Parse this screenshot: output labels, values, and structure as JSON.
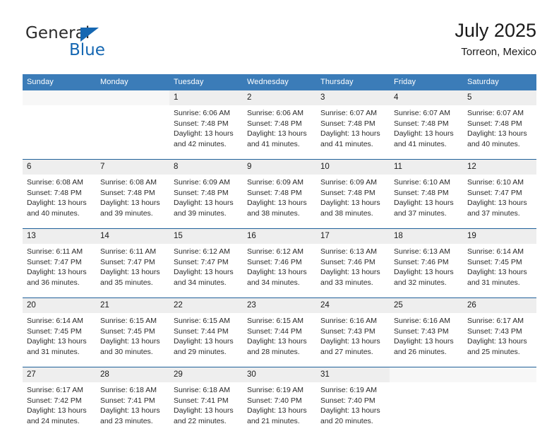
{
  "logo": {
    "word1": "General",
    "word2": "Blue",
    "triangle_color": "#1567b2"
  },
  "header": {
    "title": "July 2025",
    "subtitle": "Torreon, Mexico"
  },
  "theme": {
    "header_blue": "#3b7cb8",
    "separator_blue": "#1f6099",
    "daynum_band": "#eeeeee"
  },
  "weekdays": [
    "Sunday",
    "Monday",
    "Tuesday",
    "Wednesday",
    "Thursday",
    "Friday",
    "Saturday"
  ],
  "weeks": [
    {
      "days": [
        {
          "num": "",
          "sunrise": "",
          "sunset": "",
          "daylight1": "",
          "daylight2": ""
        },
        {
          "num": "",
          "sunrise": "",
          "sunset": "",
          "daylight1": "",
          "daylight2": ""
        },
        {
          "num": "1",
          "sunrise": "Sunrise: 6:06 AM",
          "sunset": "Sunset: 7:48 PM",
          "daylight1": "Daylight: 13 hours",
          "daylight2": "and 42 minutes."
        },
        {
          "num": "2",
          "sunrise": "Sunrise: 6:06 AM",
          "sunset": "Sunset: 7:48 PM",
          "daylight1": "Daylight: 13 hours",
          "daylight2": "and 41 minutes."
        },
        {
          "num": "3",
          "sunrise": "Sunrise: 6:07 AM",
          "sunset": "Sunset: 7:48 PM",
          "daylight1": "Daylight: 13 hours",
          "daylight2": "and 41 minutes."
        },
        {
          "num": "4",
          "sunrise": "Sunrise: 6:07 AM",
          "sunset": "Sunset: 7:48 PM",
          "daylight1": "Daylight: 13 hours",
          "daylight2": "and 41 minutes."
        },
        {
          "num": "5",
          "sunrise": "Sunrise: 6:07 AM",
          "sunset": "Sunset: 7:48 PM",
          "daylight1": "Daylight: 13 hours",
          "daylight2": "and 40 minutes."
        }
      ]
    },
    {
      "days": [
        {
          "num": "6",
          "sunrise": "Sunrise: 6:08 AM",
          "sunset": "Sunset: 7:48 PM",
          "daylight1": "Daylight: 13 hours",
          "daylight2": "and 40 minutes."
        },
        {
          "num": "7",
          "sunrise": "Sunrise: 6:08 AM",
          "sunset": "Sunset: 7:48 PM",
          "daylight1": "Daylight: 13 hours",
          "daylight2": "and 39 minutes."
        },
        {
          "num": "8",
          "sunrise": "Sunrise: 6:09 AM",
          "sunset": "Sunset: 7:48 PM",
          "daylight1": "Daylight: 13 hours",
          "daylight2": "and 39 minutes."
        },
        {
          "num": "9",
          "sunrise": "Sunrise: 6:09 AM",
          "sunset": "Sunset: 7:48 PM",
          "daylight1": "Daylight: 13 hours",
          "daylight2": "and 38 minutes."
        },
        {
          "num": "10",
          "sunrise": "Sunrise: 6:09 AM",
          "sunset": "Sunset: 7:48 PM",
          "daylight1": "Daylight: 13 hours",
          "daylight2": "and 38 minutes."
        },
        {
          "num": "11",
          "sunrise": "Sunrise: 6:10 AM",
          "sunset": "Sunset: 7:48 PM",
          "daylight1": "Daylight: 13 hours",
          "daylight2": "and 37 minutes."
        },
        {
          "num": "12",
          "sunrise": "Sunrise: 6:10 AM",
          "sunset": "Sunset: 7:47 PM",
          "daylight1": "Daylight: 13 hours",
          "daylight2": "and 37 minutes."
        }
      ]
    },
    {
      "days": [
        {
          "num": "13",
          "sunrise": "Sunrise: 6:11 AM",
          "sunset": "Sunset: 7:47 PM",
          "daylight1": "Daylight: 13 hours",
          "daylight2": "and 36 minutes."
        },
        {
          "num": "14",
          "sunrise": "Sunrise: 6:11 AM",
          "sunset": "Sunset: 7:47 PM",
          "daylight1": "Daylight: 13 hours",
          "daylight2": "and 35 minutes."
        },
        {
          "num": "15",
          "sunrise": "Sunrise: 6:12 AM",
          "sunset": "Sunset: 7:47 PM",
          "daylight1": "Daylight: 13 hours",
          "daylight2": "and 34 minutes."
        },
        {
          "num": "16",
          "sunrise": "Sunrise: 6:12 AM",
          "sunset": "Sunset: 7:46 PM",
          "daylight1": "Daylight: 13 hours",
          "daylight2": "and 34 minutes."
        },
        {
          "num": "17",
          "sunrise": "Sunrise: 6:13 AM",
          "sunset": "Sunset: 7:46 PM",
          "daylight1": "Daylight: 13 hours",
          "daylight2": "and 33 minutes."
        },
        {
          "num": "18",
          "sunrise": "Sunrise: 6:13 AM",
          "sunset": "Sunset: 7:46 PM",
          "daylight1": "Daylight: 13 hours",
          "daylight2": "and 32 minutes."
        },
        {
          "num": "19",
          "sunrise": "Sunrise: 6:14 AM",
          "sunset": "Sunset: 7:45 PM",
          "daylight1": "Daylight: 13 hours",
          "daylight2": "and 31 minutes."
        }
      ]
    },
    {
      "days": [
        {
          "num": "20",
          "sunrise": "Sunrise: 6:14 AM",
          "sunset": "Sunset: 7:45 PM",
          "daylight1": "Daylight: 13 hours",
          "daylight2": "and 31 minutes."
        },
        {
          "num": "21",
          "sunrise": "Sunrise: 6:15 AM",
          "sunset": "Sunset: 7:45 PM",
          "daylight1": "Daylight: 13 hours",
          "daylight2": "and 30 minutes."
        },
        {
          "num": "22",
          "sunrise": "Sunrise: 6:15 AM",
          "sunset": "Sunset: 7:44 PM",
          "daylight1": "Daylight: 13 hours",
          "daylight2": "and 29 minutes."
        },
        {
          "num": "23",
          "sunrise": "Sunrise: 6:15 AM",
          "sunset": "Sunset: 7:44 PM",
          "daylight1": "Daylight: 13 hours",
          "daylight2": "and 28 minutes."
        },
        {
          "num": "24",
          "sunrise": "Sunrise: 6:16 AM",
          "sunset": "Sunset: 7:43 PM",
          "daylight1": "Daylight: 13 hours",
          "daylight2": "and 27 minutes."
        },
        {
          "num": "25",
          "sunrise": "Sunrise: 6:16 AM",
          "sunset": "Sunset: 7:43 PM",
          "daylight1": "Daylight: 13 hours",
          "daylight2": "and 26 minutes."
        },
        {
          "num": "26",
          "sunrise": "Sunrise: 6:17 AM",
          "sunset": "Sunset: 7:43 PM",
          "daylight1": "Daylight: 13 hours",
          "daylight2": "and 25 minutes."
        }
      ]
    },
    {
      "days": [
        {
          "num": "27",
          "sunrise": "Sunrise: 6:17 AM",
          "sunset": "Sunset: 7:42 PM",
          "daylight1": "Daylight: 13 hours",
          "daylight2": "and 24 minutes."
        },
        {
          "num": "28",
          "sunrise": "Sunrise: 6:18 AM",
          "sunset": "Sunset: 7:41 PM",
          "daylight1": "Daylight: 13 hours",
          "daylight2": "and 23 minutes."
        },
        {
          "num": "29",
          "sunrise": "Sunrise: 6:18 AM",
          "sunset": "Sunset: 7:41 PM",
          "daylight1": "Daylight: 13 hours",
          "daylight2": "and 22 minutes."
        },
        {
          "num": "30",
          "sunrise": "Sunrise: 6:19 AM",
          "sunset": "Sunset: 7:40 PM",
          "daylight1": "Daylight: 13 hours",
          "daylight2": "and 21 minutes."
        },
        {
          "num": "31",
          "sunrise": "Sunrise: 6:19 AM",
          "sunset": "Sunset: 7:40 PM",
          "daylight1": "Daylight: 13 hours",
          "daylight2": "and 20 minutes."
        },
        {
          "num": "",
          "sunrise": "",
          "sunset": "",
          "daylight1": "",
          "daylight2": ""
        },
        {
          "num": "",
          "sunrise": "",
          "sunset": "",
          "daylight1": "",
          "daylight2": ""
        }
      ]
    }
  ]
}
